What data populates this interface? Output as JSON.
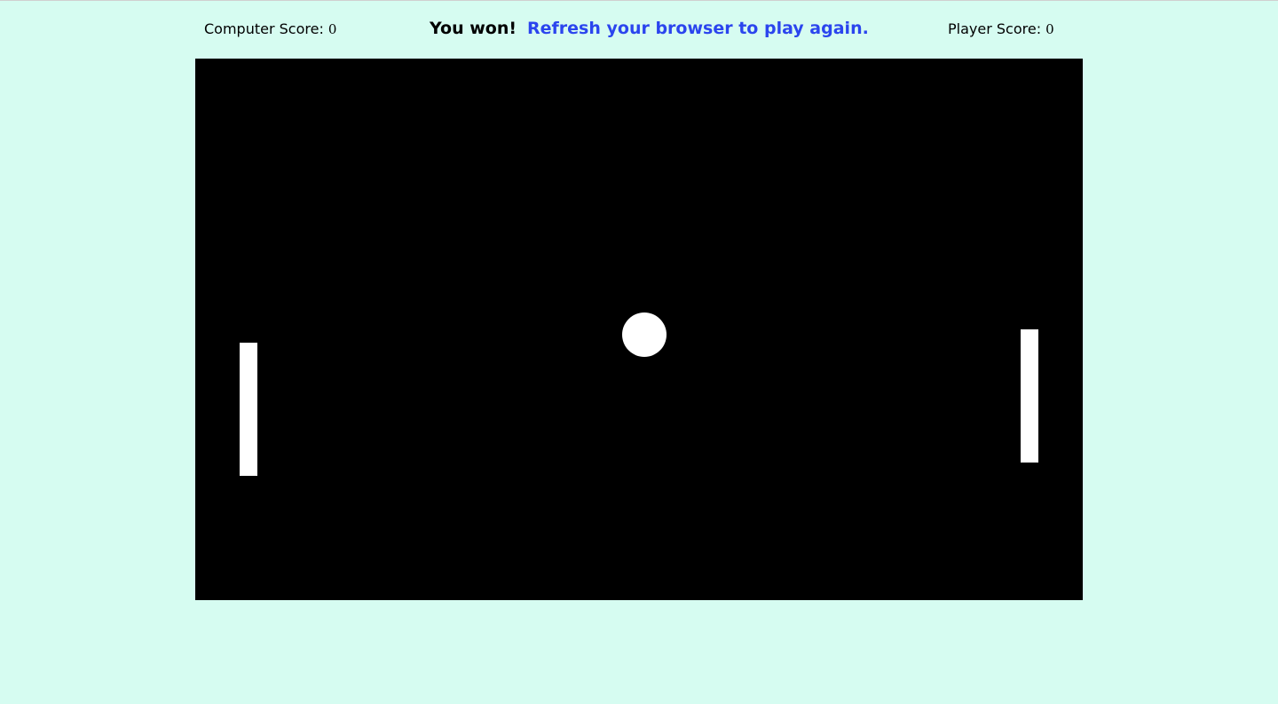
{
  "colors": {
    "page_background": "#d6fcf1",
    "top_rule": "#d0d0d0",
    "text": "#000000",
    "link_accent": "#2b45ee",
    "board": "#000000",
    "piece": "#ffffff"
  },
  "scoreboard": {
    "computer": {
      "label": "Computer Score: ",
      "value": "0"
    },
    "player": {
      "label": "Player Score: ",
      "value": "0"
    }
  },
  "status": {
    "result": "You won!",
    "hint": "Refresh your browser to play again."
  }
}
